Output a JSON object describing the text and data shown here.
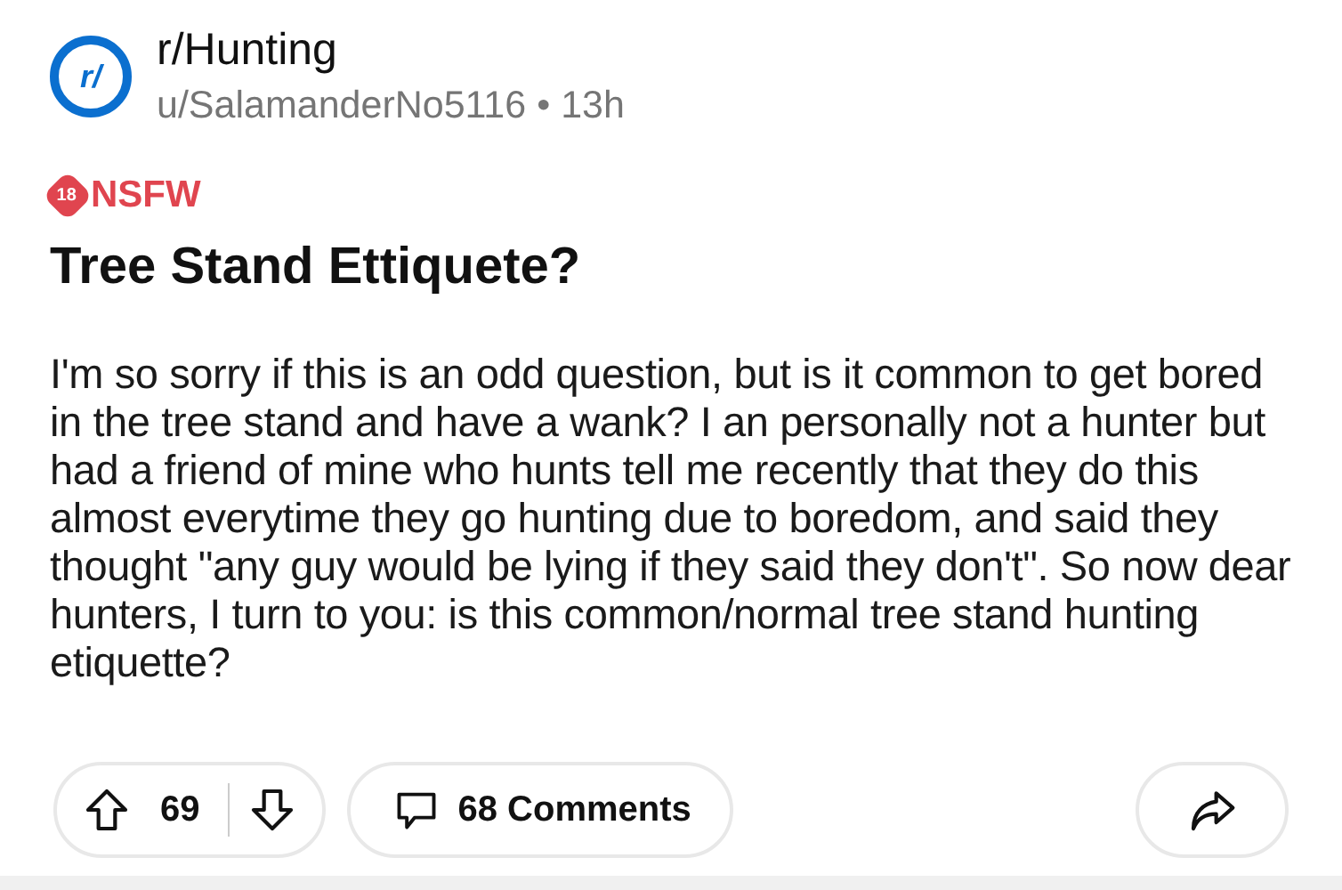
{
  "post": {
    "subreddit": "r/Hunting",
    "avatar_text": "r/",
    "author": "u/SalamanderNo5116",
    "separator": "•",
    "age": "13h",
    "nsfw": {
      "badge": "18",
      "label": "NSFW"
    },
    "title": "Tree Stand Ettiquete?",
    "body": "I'm so sorry if this is an odd question, but is it common to get bored in the tree stand and have a wank? I an personally not a hunter but had a friend of mine who hunts tell me recently that they do this almost everytime they go hunting due to boredom, and said they thought \"any guy would be lying if they said they don't\". So now dear hunters, I turn to you: is this common/normal tree stand hunting etiquette?"
  },
  "actions": {
    "votes": "69",
    "comments": "68 Comments"
  }
}
